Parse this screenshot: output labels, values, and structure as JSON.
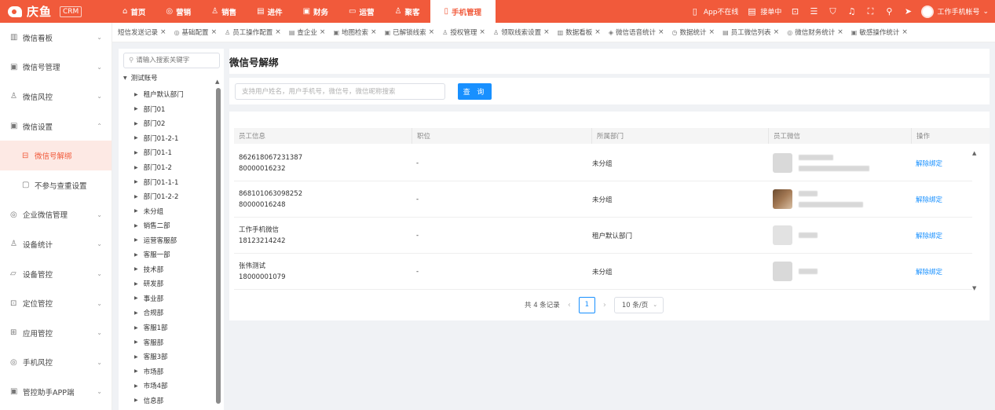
{
  "brand": {
    "name": "庆鱼",
    "badge": "CRM"
  },
  "nav": [
    {
      "icon": "⌂",
      "label": "首页"
    },
    {
      "icon": "◎",
      "label": "营销"
    },
    {
      "icon": "♙",
      "label": "销售"
    },
    {
      "icon": "▤",
      "label": "进件"
    },
    {
      "icon": "▣",
      "label": "财务"
    },
    {
      "icon": "▭",
      "label": "运营"
    },
    {
      "icon": "♙",
      "label": "聚客"
    },
    {
      "icon": "▯",
      "label": "手机管理"
    }
  ],
  "topbar": {
    "app_status": "App不在线",
    "orders": "接单中",
    "account": "工作手机帐号"
  },
  "sidebar": [
    {
      "icon": "▥",
      "label": "微信看板",
      "chev": "⌄"
    },
    {
      "icon": "▣",
      "label": "微信号管理",
      "chev": "⌄"
    },
    {
      "icon": "♙",
      "label": "微信风控",
      "chev": "⌄"
    },
    {
      "icon": "▣",
      "label": "微信设置",
      "chev": "⌃"
    },
    {
      "icon": "⊟",
      "label": "微信号解绑",
      "chev": ""
    },
    {
      "icon": "▢",
      "label": "不参与查重设置",
      "chev": ""
    },
    {
      "icon": "◎",
      "label": "企业微信管理",
      "chev": "⌄"
    },
    {
      "icon": "♙",
      "label": "设备统计",
      "chev": "⌄"
    },
    {
      "icon": "▱",
      "label": "设备管控",
      "chev": "⌄"
    },
    {
      "icon": "⊡",
      "label": "定位管控",
      "chev": "⌄"
    },
    {
      "icon": "⊞",
      "label": "应用管控",
      "chev": "⌄"
    },
    {
      "icon": "◎",
      "label": "手机风控",
      "chev": "⌄"
    },
    {
      "icon": "▣",
      "label": "管控助手APP端",
      "chev": "⌄"
    }
  ],
  "tabs": [
    {
      "icon": "",
      "label": "短信发送记录"
    },
    {
      "icon": "◎",
      "label": "基础配置"
    },
    {
      "icon": "♙",
      "label": "员工操作配置"
    },
    {
      "icon": "▤",
      "label": "查企业"
    },
    {
      "icon": "▣",
      "label": "地图检索"
    },
    {
      "icon": "▣",
      "label": "已解锁线索"
    },
    {
      "icon": "♙",
      "label": "授权管理"
    },
    {
      "icon": "♙",
      "label": "领取线索设置"
    },
    {
      "icon": "▥",
      "label": "数据看板"
    },
    {
      "icon": "◈",
      "label": "微信语音统计"
    },
    {
      "icon": "◷",
      "label": "数据统计"
    },
    {
      "icon": "▤",
      "label": "员工微信列表"
    },
    {
      "icon": "◎",
      "label": "微信财务统计"
    },
    {
      "icon": "▣",
      "label": "敏感操作统计"
    }
  ],
  "tree": {
    "placeholder": "请输入搜索关键字",
    "root": "测试账号",
    "nodes": [
      "租户默认部门",
      "部门01",
      "部门02",
      "部门01-2-1",
      "部门01-1",
      "部门01-2",
      "部门01-1-1",
      "部门01-2-2",
      "未分组",
      "销售二部",
      "运营客服部",
      "客服一部",
      "技术部",
      "研发部",
      "事业部",
      "合规部",
      "客服1部",
      "客服部",
      "客服3部",
      "市场部",
      "市场4部",
      "信息部"
    ]
  },
  "page": {
    "title": "微信号解绑",
    "search_placeholder": "支持用户姓名，用户手机号，微信号，微信昵称搜索",
    "search_button": "查 询"
  },
  "table": {
    "headers": [
      "员工信息",
      "职位",
      "所属部门",
      "员工微信",
      "操作"
    ],
    "rows": [
      {
        "id": "862618067231387",
        "phone": "80000016232",
        "position": "-",
        "dept": "未分组",
        "avatar": "plain",
        "action": "解除绑定"
      },
      {
        "id": "868101063098252",
        "phone": "80000016248",
        "position": "-",
        "dept": "未分组",
        "avatar": "photo",
        "action": "解除绑定"
      },
      {
        "id": "工作手机微信",
        "phone": "18123214242",
        "position": "-",
        "dept": "租户默认部门",
        "avatar": "light",
        "action": "解除绑定"
      },
      {
        "id": "张伟测试",
        "phone": "18000001079",
        "position": "-",
        "dept": "未分组",
        "avatar": "plain",
        "action": "解除绑定"
      }
    ]
  },
  "pager": {
    "total": "共 4 条记录",
    "current": "1",
    "page_size": "10 条/页"
  },
  "colors": {
    "brand": "#f15a3b",
    "primary": "#1890ff"
  }
}
